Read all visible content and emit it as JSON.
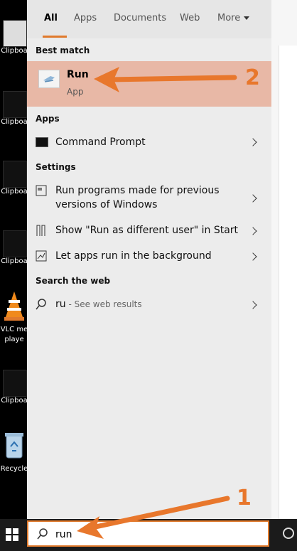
{
  "desktop": {
    "icons": [
      {
        "label": "Clipboa"
      },
      {
        "label": "Clipboa"
      },
      {
        "label": "Clipboa"
      },
      {
        "label": "Clipboa"
      },
      {
        "label": "VLC me"
      },
      {
        "label": "playe"
      },
      {
        "label": "Clipboa"
      },
      {
        "label": "Recycle"
      }
    ]
  },
  "tabs": [
    "All",
    "Apps",
    "Documents",
    "Web",
    "More"
  ],
  "sections": {
    "best_match": "Best match",
    "apps": "Apps",
    "settings": "Settings",
    "search_web": "Search the web"
  },
  "best_match": {
    "title": "Run",
    "subtitle": "App"
  },
  "apps": [
    {
      "label": "Command Prompt"
    }
  ],
  "settings": [
    {
      "line1": "Run programs made for previous",
      "line2": "versions of Windows"
    },
    {
      "label": "Show \"Run as different user\" in Start"
    },
    {
      "label": "Let apps run in the background"
    }
  ],
  "web": {
    "query": "ru",
    "hint": " - See web results"
  },
  "search": {
    "value": "run"
  },
  "annotations": {
    "num1": "1",
    "num2": "2",
    "color": "#e8772c"
  }
}
